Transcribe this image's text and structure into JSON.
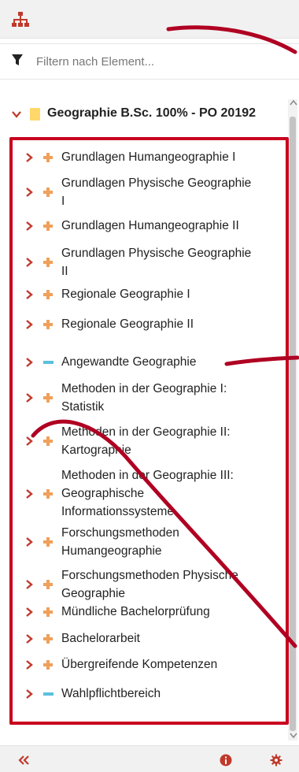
{
  "filter": {
    "placeholder": "Filtern nach Element..."
  },
  "tree": {
    "root_label": "Geographie B.Sc. 100% - PO 20192",
    "items": [
      {
        "label": "Grundlagen Humangeographie I",
        "marker": "plus-icon",
        "lines": [
          "Grundlagen Humangeographie I"
        ]
      },
      {
        "label": "Grundlagen Physische Geographie I",
        "marker": "plus-icon",
        "lines": [
          "Grundlagen Physische Geographie",
          "I"
        ]
      },
      {
        "label": "Grundlagen Humangeographie II",
        "marker": "plus-icon",
        "lines": [
          "Grundlagen Humangeographie II"
        ]
      },
      {
        "label": "Grundlagen Physische Geographie II",
        "marker": "plus-icon",
        "lines": [
          "Grundlagen Physische Geographie",
          "II"
        ]
      },
      {
        "label": "Regionale Geographie I",
        "marker": "plus-icon",
        "lines": [
          "Regionale Geographie I"
        ]
      },
      {
        "label": "Regionale Geographie II",
        "marker": "plus-icon",
        "lines": [
          "Regionale Geographie II"
        ]
      },
      {
        "label": "Angewandte Geographie",
        "marker": "minus-icon",
        "lines": [
          "Angewandte Geographie"
        ]
      },
      {
        "label": "Methoden in der Geographie I: Statistik",
        "marker": "plus-icon",
        "lines": [
          "Methoden in der Geographie I:",
          "Statistik"
        ]
      },
      {
        "label": "Methoden in der Geographie II: Kartographie",
        "marker": "plus-icon",
        "lines": [
          "Methoden in der Geographie II:",
          "Kartographie"
        ]
      },
      {
        "label": "Methoden in der Geographie III: Geographische Informationssysteme",
        "marker": "plus-icon",
        "lines": [
          "Methoden in der Geographie III:",
          "Geographische",
          "Informationssysteme"
        ]
      },
      {
        "label": "Forschungsmethoden Humangeographie",
        "marker": "plus-icon",
        "lines": [
          "Forschungsmethoden",
          "Humangeographie"
        ]
      },
      {
        "label": "Forschungsmethoden Physische Geographie",
        "marker": "plus-icon",
        "lines": [
          "Forschungsmethoden Physische",
          "Geographie"
        ]
      },
      {
        "label": "Mündliche Bachelorprüfung",
        "marker": "plus-icon",
        "lines": [
          "Mündliche Bachelorprüfung"
        ]
      },
      {
        "label": "Bachelorarbeit",
        "marker": "plus-icon",
        "lines": [
          "Bachelorarbeit"
        ]
      },
      {
        "label": "Übergreifende Kompetenzen",
        "marker": "plus-icon",
        "lines": [
          "Übergreifende Kompetenzen"
        ]
      },
      {
        "label": "Wahlpflichtbereich",
        "marker": "minus-icon",
        "lines": [
          "Wahlpflichtbereich"
        ]
      }
    ]
  },
  "icons": {
    "top": "sitemap-icon",
    "filter": "filter-icon",
    "collapse_sidebar": "double-chevron-left-icon",
    "info": "info-icon",
    "settings": "gear-icon"
  },
  "colors": {
    "plus_marker": "#f0a05a",
    "minus_marker": "#5bc0de",
    "caret": "#c0392b",
    "annotation": "#b00022",
    "folder": "#ffd76b"
  }
}
